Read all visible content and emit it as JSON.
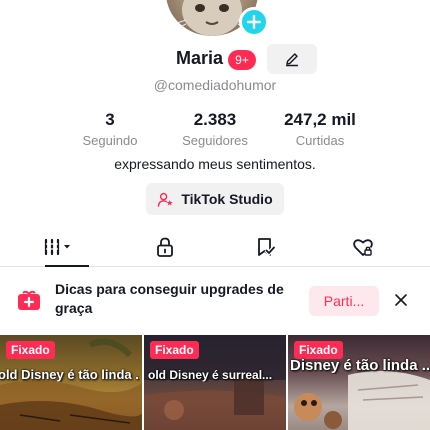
{
  "profile": {
    "name": "Maria",
    "notification_badge": "9+",
    "username": "@comediadohumor",
    "bio": "expressando meus sentimentos."
  },
  "stats": [
    {
      "value": "3",
      "label": "Seguindo"
    },
    {
      "value": "2.383",
      "label": "Seguidores"
    },
    {
      "value": "247,2 mil",
      "label": "Curtidas"
    }
  ],
  "studio_button": {
    "label": "TikTok Studio",
    "icon": "studio-star-icon"
  },
  "tabs": [
    {
      "icon": "videos-grid-icon",
      "selected": true
    },
    {
      "icon": "lock-icon",
      "selected": false
    },
    {
      "icon": "bookmark-icon",
      "selected": false
    },
    {
      "icon": "liked-heart-icon",
      "selected": false
    }
  ],
  "tip": {
    "text": "Dicas para conseguir upgrades de graça",
    "button": "Parti...",
    "icon": "gift-icon"
  },
  "videos": [
    {
      "badge": "Fixado",
      "caption": "old Disney é tão linda ..."
    },
    {
      "badge": "Fixado",
      "caption": "old Disney é surreal..."
    },
    {
      "badge": "Fixado",
      "caption": "Disney é tão linda ..."
    }
  ],
  "colors": {
    "accent": "#fe2c55",
    "add_button": "#20d5ec",
    "muted_text": "#8a8b91"
  }
}
